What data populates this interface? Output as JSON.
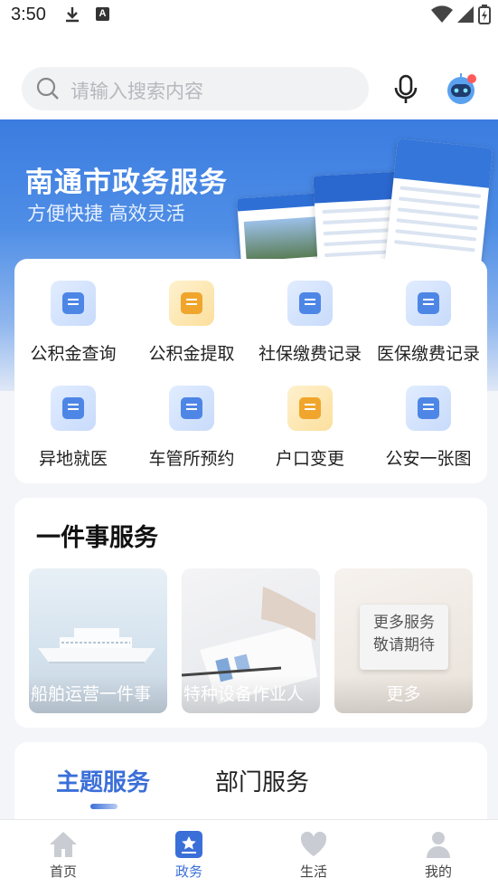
{
  "status_bar": {
    "time": "3:50",
    "badge": "A"
  },
  "search": {
    "placeholder": "请输入搜索内容"
  },
  "banner": {
    "title": "南通市政务服务",
    "subtitle": "方便快捷 高效灵活"
  },
  "services": [
    {
      "label": "公积金查询",
      "color": "blue"
    },
    {
      "label": "公积金提取",
      "color": "yellow"
    },
    {
      "label": "社保缴费记录",
      "color": "blue"
    },
    {
      "label": "医保缴费记录",
      "color": "blue"
    },
    {
      "label": "异地就医",
      "color": "blue"
    },
    {
      "label": "车管所预约",
      "color": "blue"
    },
    {
      "label": "户口变更",
      "color": "yellow"
    },
    {
      "label": "公安一张图",
      "color": "blue"
    }
  ],
  "one_thing": {
    "title": "一件事服务",
    "cards": [
      {
        "caption": "船舶运营一件事"
      },
      {
        "caption": "特种设备作业人"
      },
      {
        "caption": "更多",
        "note_line1": "更多服务",
        "note_line2": "敬请期待"
      }
    ]
  },
  "tabs": {
    "active": "主题服务",
    "inactive": "部门服务"
  },
  "bottom_nav": [
    {
      "label": "首页",
      "icon": "home-icon"
    },
    {
      "label": "政务",
      "icon": "government-star-icon"
    },
    {
      "label": "生活",
      "icon": "heart-icon"
    },
    {
      "label": "我的",
      "icon": "user-icon"
    }
  ],
  "colors": {
    "accent": "#3b6fd8",
    "banner": "#3b7ce0"
  }
}
